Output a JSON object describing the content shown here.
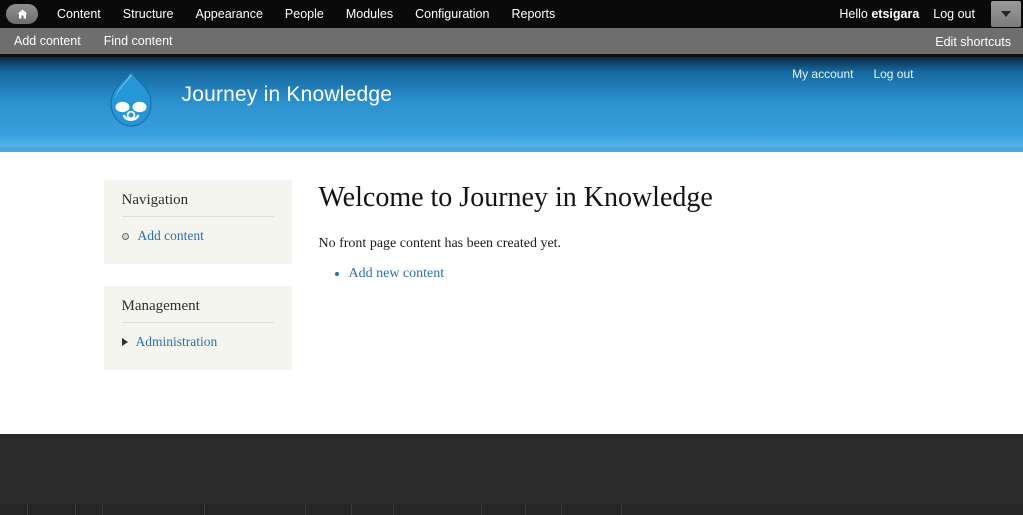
{
  "admin_toolbar": {
    "home_icon": "home-icon",
    "menu": [
      {
        "label": "Content"
      },
      {
        "label": "Structure"
      },
      {
        "label": "Appearance"
      },
      {
        "label": "People"
      },
      {
        "label": "Modules"
      },
      {
        "label": "Configuration"
      },
      {
        "label": "Reports"
      }
    ],
    "greeting_prefix": "Hello ",
    "username": "etsigara",
    "logout_label": "Log out",
    "toggle_icon": "chevron-down-icon",
    "background_color": "#0a0a0a"
  },
  "shortcut_bar": {
    "links": [
      {
        "label": "Add content"
      },
      {
        "label": "Find content"
      }
    ],
    "edit_label": "Edit shortcuts",
    "background_color": "#6e6e6e"
  },
  "banner": {
    "logo_icon": "drupal-droplet-logo",
    "site_name": "Journey in Knowledge",
    "links": [
      {
        "label": "My account"
      },
      {
        "label": "Log out"
      }
    ],
    "accent_color": "#2a8fcd"
  },
  "sidebar": {
    "blocks": [
      {
        "title": "Navigation",
        "items": [
          {
            "label": "Add content",
            "marker": "hollow-circle-bullet"
          }
        ]
      },
      {
        "title": "Management",
        "items": [
          {
            "label": "Administration",
            "marker": "collapsed-triangle-icon"
          }
        ]
      }
    ],
    "block_background": "#f5f5f0",
    "link_color": "#2f6ea5"
  },
  "main": {
    "title": "Welcome to Journey in Knowledge",
    "body_text": "No front page content has been created yet.",
    "links": [
      {
        "label": "Add new content"
      }
    ]
  },
  "footer": {
    "background_color": "#2b2b2b"
  }
}
